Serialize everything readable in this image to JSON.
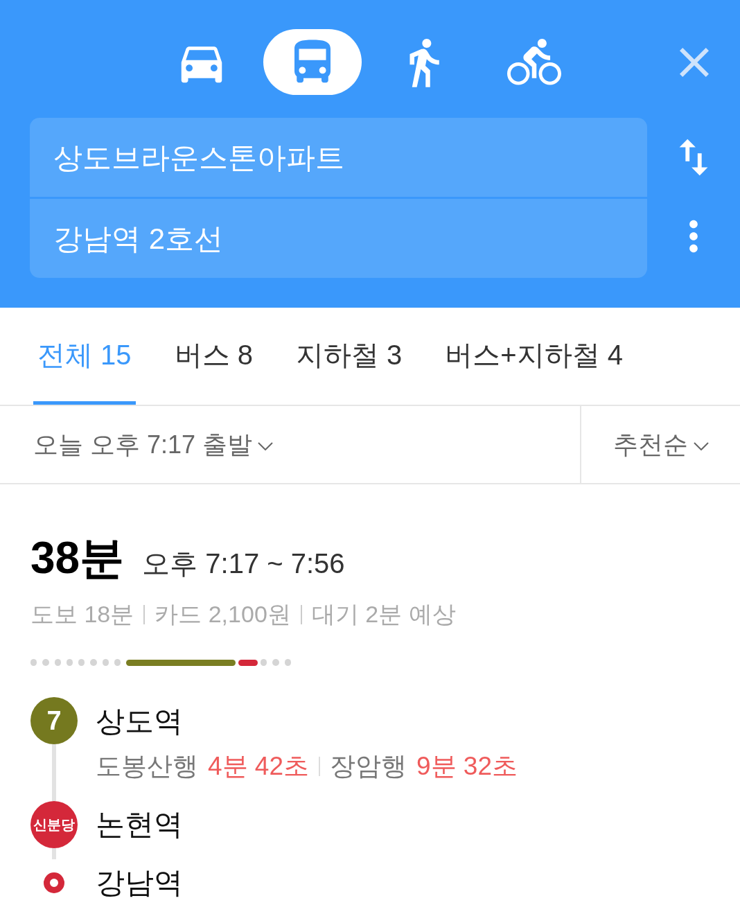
{
  "modes": [
    {
      "kind": "car",
      "selected": false
    },
    {
      "kind": "bus",
      "selected": true
    },
    {
      "kind": "walk",
      "selected": false
    },
    {
      "kind": "bike",
      "selected": false
    }
  ],
  "origin": {
    "value": "상도브라운스톤아파트"
  },
  "destination": {
    "value": "강남역 2호선"
  },
  "tabs": [
    {
      "label": "전체 15",
      "selected": true
    },
    {
      "label": "버스 8",
      "selected": false
    },
    {
      "label": "지하철 3",
      "selected": false
    },
    {
      "label": "버스+지하철 4",
      "selected": false
    }
  ],
  "departure": "오늘 오후 7:17 출발",
  "sort": "추천순",
  "route": {
    "duration": "38분",
    "time_range": "오후 7:17 ~ 7:56",
    "summary": [
      "도보 18분",
      "카드 2,100원",
      "대기 2분 예상"
    ],
    "segments": [
      {
        "kind": "dot"
      },
      {
        "kind": "dot"
      },
      {
        "kind": "dot"
      },
      {
        "kind": "dot"
      },
      {
        "kind": "dot"
      },
      {
        "kind": "dot"
      },
      {
        "kind": "dot"
      },
      {
        "kind": "dot"
      },
      {
        "kind": "long",
        "color": "#7a7e22"
      },
      {
        "kind": "short",
        "color": "#d4283a"
      },
      {
        "kind": "dot"
      },
      {
        "kind": "dot"
      },
      {
        "kind": "dot"
      }
    ],
    "stops": [
      {
        "kind": "badge",
        "badge": "7",
        "color": "#75791f",
        "name": "상도역",
        "arrivals": [
          {
            "direction": "도봉산행",
            "time": "4분 42초"
          },
          {
            "direction": "장암행",
            "time": "9분 32초"
          }
        ]
      },
      {
        "kind": "badge",
        "badge": "신분당",
        "color": "#d4283a",
        "name": "논현역"
      },
      {
        "kind": "end",
        "color": "#d4283a",
        "name": "강남역"
      }
    ]
  }
}
